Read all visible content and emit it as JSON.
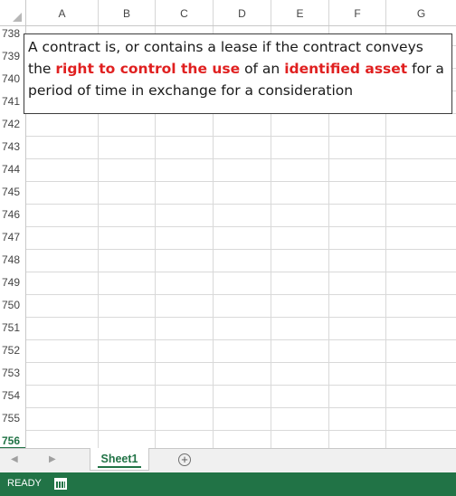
{
  "columns": [
    "A",
    "B",
    "C",
    "D",
    "E",
    "F",
    "G"
  ],
  "rows": [
    "738",
    "739",
    "740",
    "741",
    "742",
    "743",
    "744",
    "745",
    "746",
    "747",
    "748",
    "749",
    "750",
    "751",
    "752",
    "753",
    "754",
    "755",
    "756"
  ],
  "active_row": "756",
  "textbox": {
    "part1": "A contract is, or contains a lease if the contract conveys the ",
    "highlight1": "right to control the use",
    "part2": " of an ",
    "highlight2": "identified asset",
    "part3": " for a period of time in exchange for a consideration"
  },
  "sheet_tabs": [
    "Sheet1"
  ],
  "status": "READY",
  "colors": {
    "accent": "#217346",
    "highlight": "#e02020"
  },
  "icons": [
    "prev-sheet-icon",
    "next-sheet-icon",
    "add-sheet-icon",
    "macro-record-icon"
  ]
}
